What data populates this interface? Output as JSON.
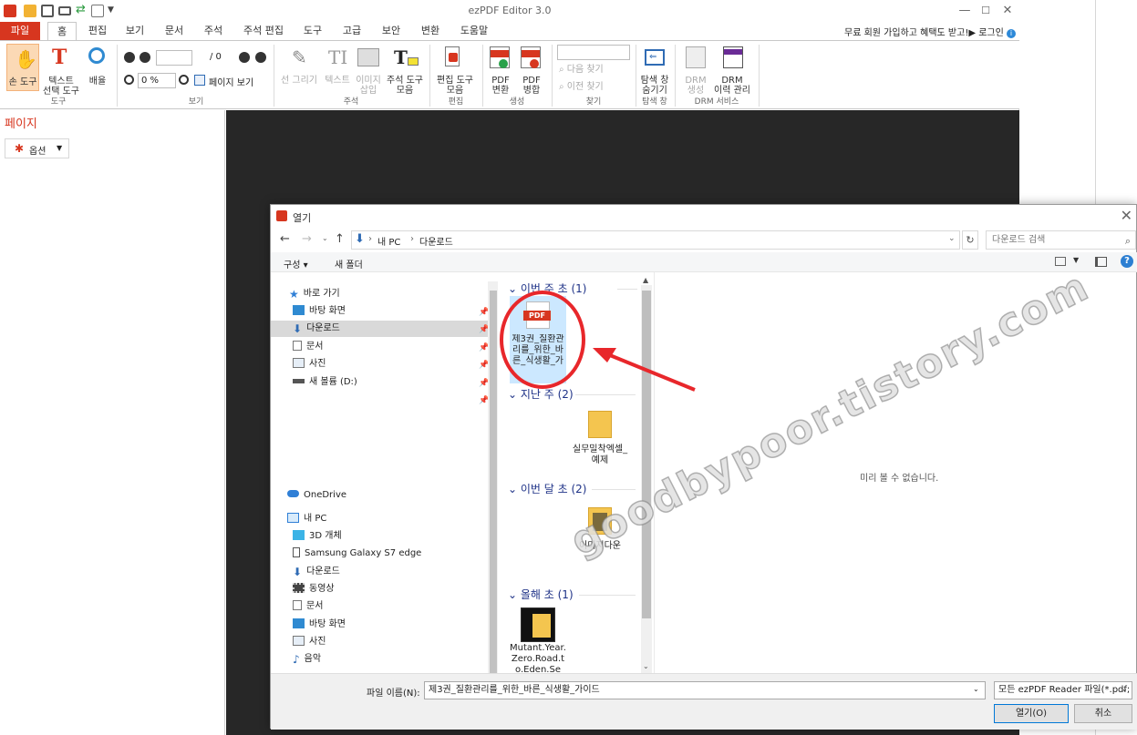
{
  "app": {
    "title": "ezPDF Editor 3.0",
    "member_text": "무료 회원 가입하고 혜택도 받고!▶ 로그인",
    "tabs": [
      "파일",
      "홈",
      "편집",
      "보기",
      "문서",
      "주석",
      "주석 편집",
      "도구",
      "고급",
      "보안",
      "변환",
      "도움말"
    ],
    "accent": "#d7361f"
  },
  "ribbon": {
    "hand_tool": "손 도구",
    "text_select": "텍스트\n선택 도구",
    "zoom": "배율",
    "group_tools": "도구",
    "page_of": "/ 0",
    "zoom_value": "0 %",
    "page_view": "페이지 보기",
    "group_view": "보기",
    "draw_line": "선 그리기",
    "text": "텍스트",
    "insert_image": "이미지\n삽입",
    "annot_tools": "주석 도구\n모음",
    "group_annot": "주석",
    "edit_tools": "편집 도구\n모음",
    "group_edit": "편집",
    "pdf_convert": "PDF\n변환",
    "pdf_merge": "PDF\n병합",
    "group_create": "생성",
    "find_next": "다음 찾기",
    "find_prev": "이전 찾기",
    "group_find": "찾기",
    "hide_nav": "탐색 창\n숨기기",
    "group_nav": "탐색 창",
    "drm_create": "DRM\n생성",
    "drm_history": "DRM\n이력 관리",
    "group_drm": "DRM 서비스"
  },
  "left_panel": {
    "title": "페이지",
    "options": "옵션"
  },
  "dialog": {
    "title": "열기",
    "breadcrumb": [
      "내 PC",
      "다운로드"
    ],
    "search_placeholder": "다운로드 검색",
    "organize": "구성",
    "new_folder": "새 폴더",
    "nav": {
      "quick_access": "바로 가기",
      "quick": [
        {
          "label": "바탕 화면",
          "icon": "desktop-icon"
        },
        {
          "label": "다운로드",
          "icon": "download-icon"
        },
        {
          "label": "문서",
          "icon": "document-icon"
        },
        {
          "label": "사진",
          "icon": "picture-icon"
        },
        {
          "label": "새 볼륨 (D:)",
          "icon": "drive-icon"
        }
      ],
      "onedrive": "OneDrive",
      "this_pc": "내 PC",
      "pc_items": [
        {
          "label": "3D 개체",
          "icon": "cube-icon"
        },
        {
          "label": "Samsung Galaxy S7 edge",
          "icon": "phone-icon"
        },
        {
          "label": "다운로드",
          "icon": "download-icon"
        },
        {
          "label": "동영상",
          "icon": "video-icon"
        },
        {
          "label": "문서",
          "icon": "document-icon"
        },
        {
          "label": "바탕 화면",
          "icon": "desktop-icon"
        },
        {
          "label": "사진",
          "icon": "picture-icon"
        },
        {
          "label": "음악",
          "icon": "music-icon"
        }
      ]
    },
    "groups": [
      {
        "header": "이번 주 초 (1)",
        "item": "제3권_질환관리를_위한_바른_식생활_가"
      },
      {
        "header": "지난 주 (2)",
        "item": "실무밀착엑셀_예제"
      },
      {
        "header": "이번 달 초 (2)",
        "item": "이미지다운"
      },
      {
        "header": "올해 초 (1)",
        "item": "Mutant.Year.Zero.Road.to.Eden.Se"
      }
    ],
    "preview_msg": "미리 볼 수 없습니다.",
    "filename_label": "파일 이름(N):",
    "filename_value": "제3권_질환관리를_위한_바른_식생활_가이드",
    "filetype": "모든 ezPDF Reader 파일(*.pdf;",
    "open_btn": "열기(O)",
    "cancel_btn": "취소"
  },
  "watermark": "goodbypoor.tistory.com"
}
